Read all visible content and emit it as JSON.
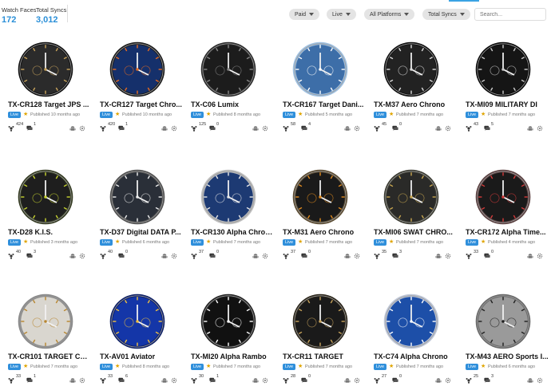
{
  "stats": {
    "watch_faces_label": "Watch Faces",
    "watch_faces_value": "172",
    "total_syncs_label": "Total Syncs",
    "total_syncs_value": "3,012"
  },
  "filters": {
    "paid": "Paid",
    "live": "Live",
    "platforms": "All Platforms",
    "syncs": "Total Syncs"
  },
  "search": {
    "placeholder": "Search..."
  },
  "status_label": "Live",
  "icons": {
    "sync": "sync-icon",
    "comments": "comments-icon",
    "android": "android-icon",
    "settings": "settings-icon",
    "star": "star-icon"
  },
  "colors": {
    "accent": "#2f8fdb",
    "star": "#e0a500",
    "chip": "#e4e4e4"
  },
  "cards": [
    {
      "title": "TX-CR128 Target JPS ...",
      "published": "Published 10 months ago",
      "syncs": "424",
      "comments": "1",
      "dial": "#2b2b2b",
      "bezel": "#111",
      "accent": "#c9a45c"
    },
    {
      "title": "TX-CR127 Target Chro...",
      "published": "Published 10 months ago",
      "syncs": "420",
      "comments": "1",
      "dial": "#15306b",
      "bezel": "#1a1a1a",
      "accent": "#e76b1f"
    },
    {
      "title": "TX-C06 Lumix",
      "published": "Published 8 months ago",
      "syncs": "125",
      "comments": "0",
      "dial": "#1c1c1c",
      "bezel": "#2a2a2a",
      "accent": "#888888"
    },
    {
      "title": "TX-CR167 Target Dani...",
      "published": "Published 5 months ago",
      "syncs": "58",
      "comments": "4",
      "dial": "#3d6ea8",
      "bezel": "#9fc1e2",
      "accent": "#ffffff"
    },
    {
      "title": "TX-M37 Aero Chrono",
      "published": "Published 7 months ago",
      "syncs": "45",
      "comments": "0",
      "dial": "#222222",
      "bezel": "#101010",
      "accent": "#dddddd"
    },
    {
      "title": "TX-MI09 MILITARY DI",
      "published": "Published 7 months ago",
      "syncs": "43",
      "comments": "5",
      "dial": "#151515",
      "bezel": "#0a0a0a",
      "accent": "#cccccc"
    },
    {
      "title": "TX-D28 K.I.S.",
      "published": "Published 3 months ago",
      "syncs": "40",
      "comments": "3",
      "dial": "#1e1e1e",
      "bezel": "#333a20",
      "accent": "#c8d430"
    },
    {
      "title": "TX-D37 Digital DATA P...",
      "published": "Published 6 months ago",
      "syncs": "40",
      "comments": "0",
      "dial": "#2a2f38",
      "bezel": "#505050",
      "accent": "#f0f0f0"
    },
    {
      "title": "TX-CR130 Alpha Chron...",
      "published": "Published 7 months ago",
      "syncs": "37",
      "comments": "0",
      "dial": "#1d3a73",
      "bezel": "#c0c0c0",
      "accent": "#e8e8e8"
    },
    {
      "title": "TX-M31 Aero Chrono",
      "published": "Published 7 months ago",
      "syncs": "37",
      "comments": "0",
      "dial": "#1a1a1a",
      "bezel": "#5a4a30",
      "accent": "#e08a1e"
    },
    {
      "title": "TX-MI06 SWAT CHRO...",
      "published": "Published 7 months ago",
      "syncs": "35",
      "comments": "3",
      "dial": "#2a2a28",
      "bezel": "#3a3a30",
      "accent": "#c8a650"
    },
    {
      "title": "TX-CR172 Alpha Time...",
      "published": "Published 4 months ago",
      "syncs": "33",
      "comments": "0",
      "dial": "#1a1a1a",
      "bezel": "#5a3f3f",
      "accent": "#d43a3a"
    },
    {
      "title": "TX-CR101 TARGET Chr...",
      "published": "Published 7 months ago",
      "syncs": "33",
      "comments": "1",
      "dial": "#d9d6cf",
      "bezel": "#8a8a8a",
      "accent": "#b8862f"
    },
    {
      "title": "TX-AV01 Aviator",
      "published": "Published 8 months ago",
      "syncs": "33",
      "comments": "6",
      "dial": "#1436a8",
      "bezel": "#0d1f66",
      "accent": "#f0c040"
    },
    {
      "title": "TX-MI20 Alpha Rambo",
      "published": "Published 7 months ago",
      "syncs": "30",
      "comments": "1",
      "dial": "#111111",
      "bezel": "#222222",
      "accent": "#ffffff"
    },
    {
      "title": "TX-CR11 TARGET",
      "published": "Published 7 months ago",
      "syncs": "28",
      "comments": "0",
      "dial": "#1a1a1a",
      "bezel": "#2a2418",
      "accent": "#c9a45c"
    },
    {
      "title": "TX-C74 Alpha Chrono",
      "published": "Published 7 months ago",
      "syncs": "27",
      "comments": "0",
      "dial": "#1d4fa8",
      "bezel": "#c0c8d8",
      "accent": "#ffffff"
    },
    {
      "title": "TX-M43 AERO Sports I...",
      "published": "Published 6 months ago",
      "syncs": "25",
      "comments": "3",
      "dial": "#9a9a9a",
      "bezel": "#6a6a6a",
      "accent": "#1e1e1e"
    }
  ]
}
